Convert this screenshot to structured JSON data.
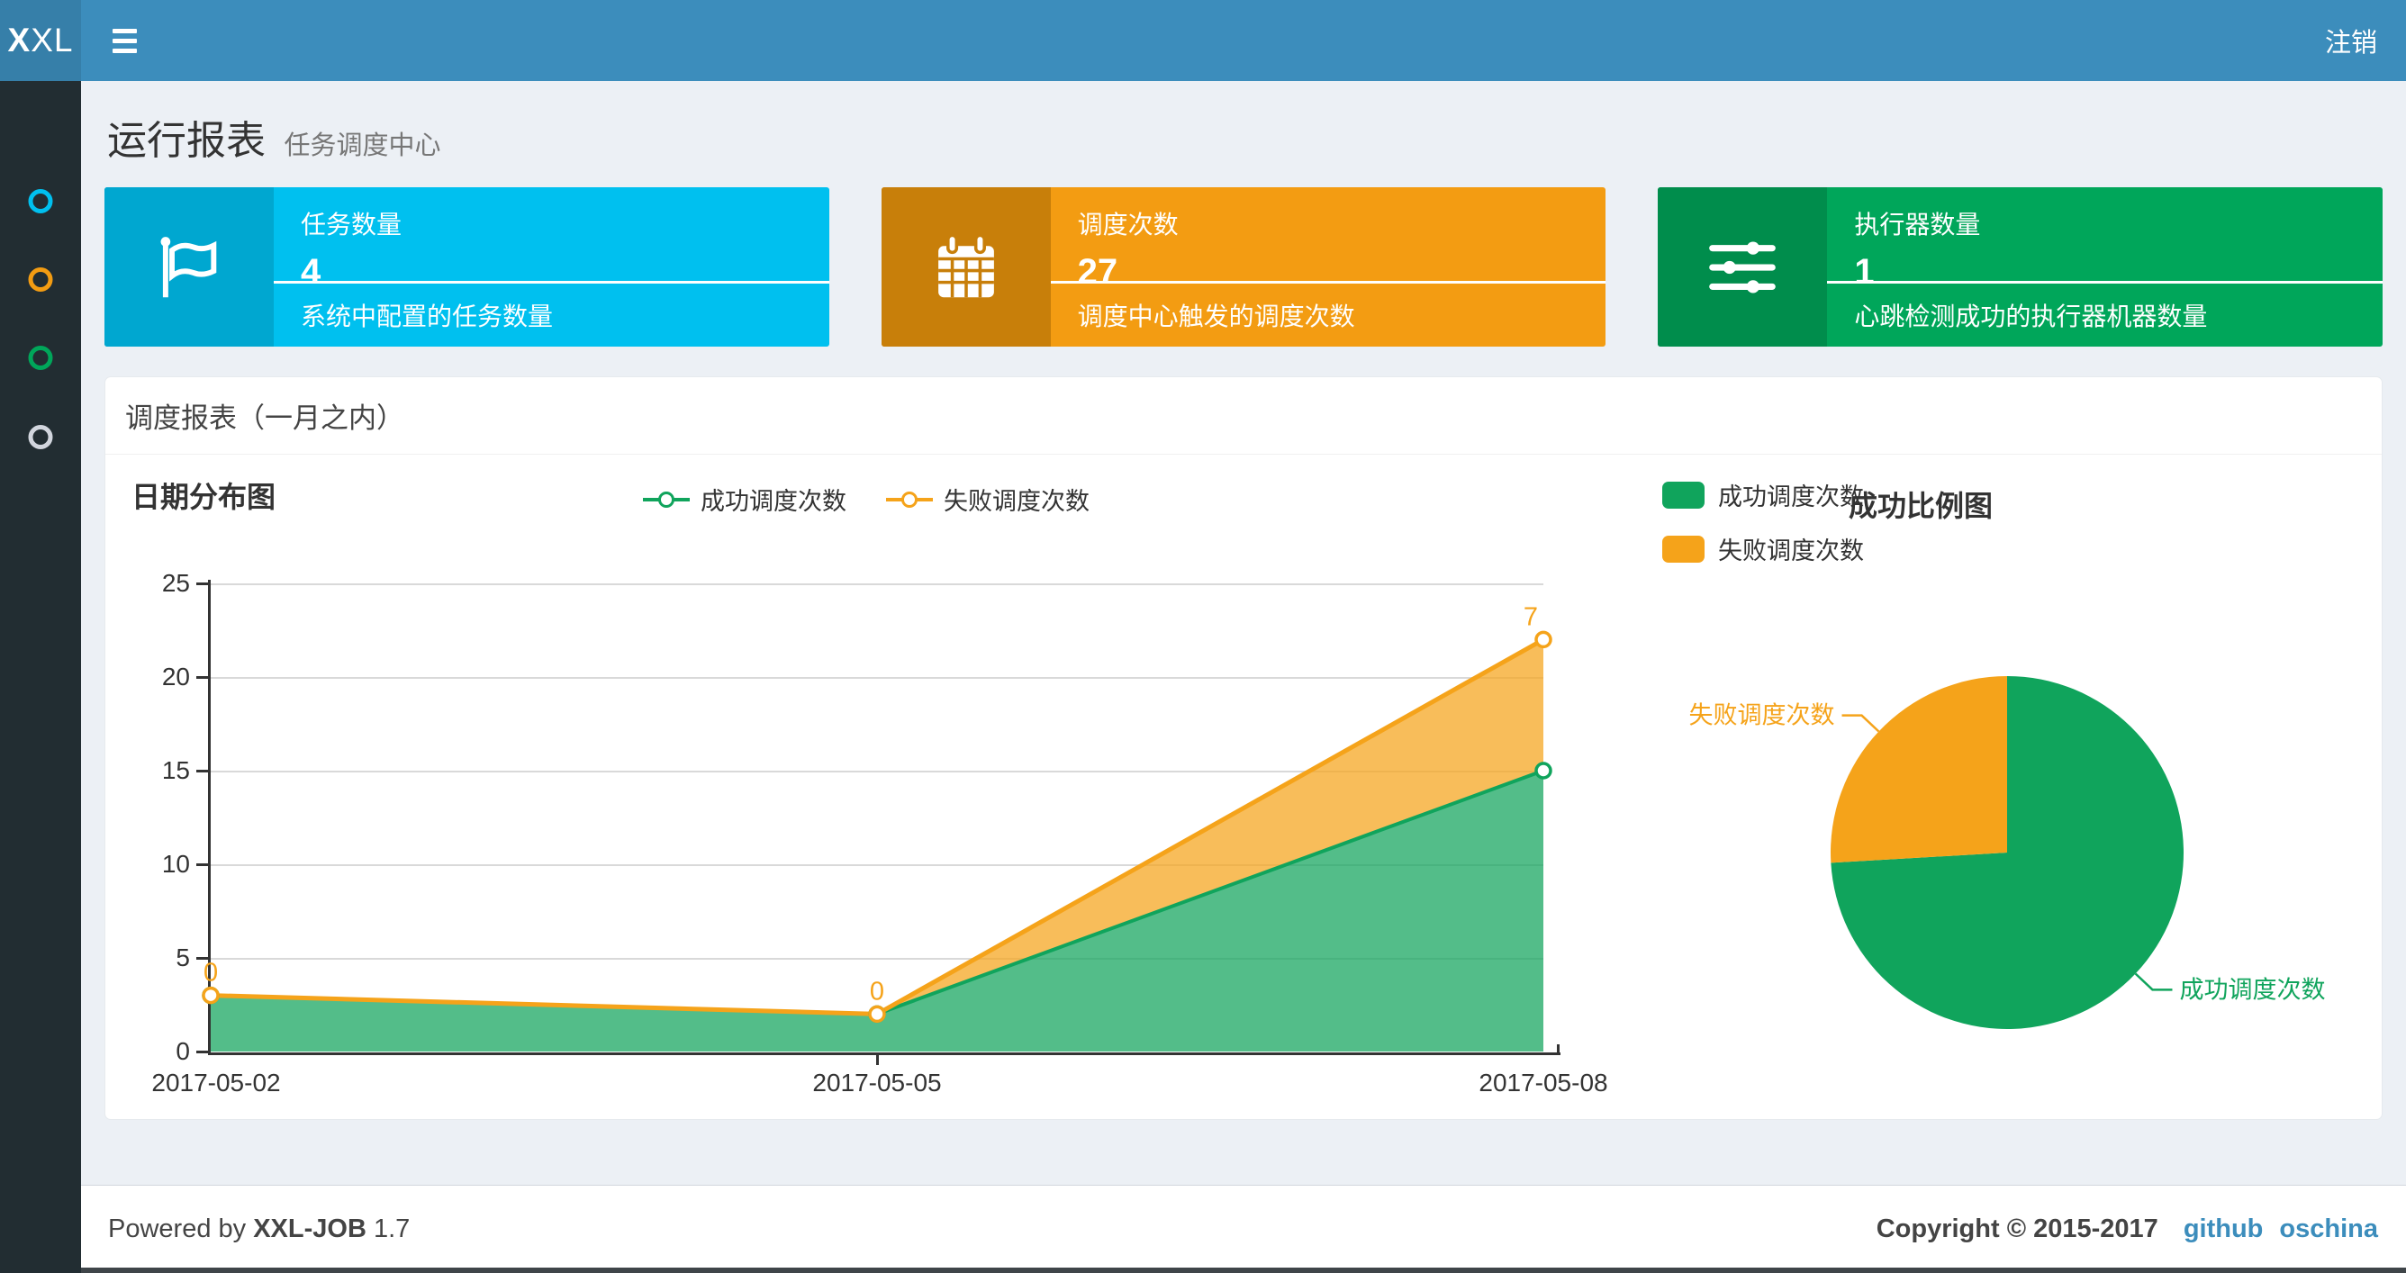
{
  "colors": {
    "header_bg": "#3c8dbc",
    "logo_bg": "#367fa9",
    "sidebar_bg": "#222d32",
    "content_bg": "#ecf0f5",
    "link": "#3c8dbc",
    "success_green": "#10a45c",
    "fail_orange": "#f5a31a"
  },
  "header": {
    "logo_bold": "X",
    "logo_rest": "XL",
    "logout_label": "注销"
  },
  "sidebar": {
    "items": [
      {
        "icon": "circle-icon",
        "color": "#00c0ef"
      },
      {
        "icon": "circle-icon",
        "color": "#f39c12"
      },
      {
        "icon": "circle-icon",
        "color": "#00a65a"
      },
      {
        "icon": "circle-icon",
        "color": "#d2d6de"
      }
    ]
  },
  "page": {
    "title": "运行报表",
    "subtitle": "任务调度中心"
  },
  "cards": [
    {
      "title": "任务数量",
      "value": "4",
      "desc": "系统中配置的任务数量",
      "color": "#00c0ef",
      "icon_bg": "#00a7d0",
      "icon": "flag-icon"
    },
    {
      "title": "调度次数",
      "value": "27",
      "desc": "调度中心触发的调度次数",
      "color": "#f39c12",
      "icon_bg": "#c87f0a",
      "icon": "calendar-icon"
    },
    {
      "title": "执行器数量",
      "value": "1",
      "desc": "心跳检测成功的执行器机器数量",
      "color": "#00a65a",
      "icon_bg": "#008d4c",
      "icon": "sliders-icon"
    }
  ],
  "panel": {
    "title": "调度报表（一月之内）"
  },
  "chart_data": [
    {
      "type": "area",
      "title": "日期分布图",
      "stacked": true,
      "x": [
        "2017-05-02",
        "2017-05-05",
        "2017-05-08"
      ],
      "series": [
        {
          "name": "成功调度次数",
          "values": [
            3,
            2,
            15
          ],
          "color": "#10a45c"
        },
        {
          "name": "失败调度次数",
          "values": [
            0,
            0,
            7
          ],
          "color": "#f5a31a"
        }
      ],
      "point_labels": {
        "series": "失败调度次数",
        "values": [
          0,
          0,
          7
        ]
      },
      "ylim": [
        0,
        25
      ],
      "yticks": [
        0,
        5,
        10,
        15,
        20,
        25
      ],
      "grid": true,
      "legend_position": "top-center"
    },
    {
      "type": "pie",
      "title": "成功比例图",
      "slices": [
        {
          "label": "成功调度次数",
          "value": 20,
          "color": "#10a45c"
        },
        {
          "label": "失败调度次数",
          "value": 7,
          "color": "#f5a31a"
        }
      ],
      "legend_position": "top-left",
      "legend": [
        "成功调度次数",
        "失败调度次数"
      ]
    }
  ],
  "footer": {
    "powered_prefix": "Powered by",
    "product": "XXL-JOB",
    "version": "1.7",
    "copyright": "Copyright © 2015-2017",
    "links": [
      "github",
      "oschina"
    ]
  }
}
